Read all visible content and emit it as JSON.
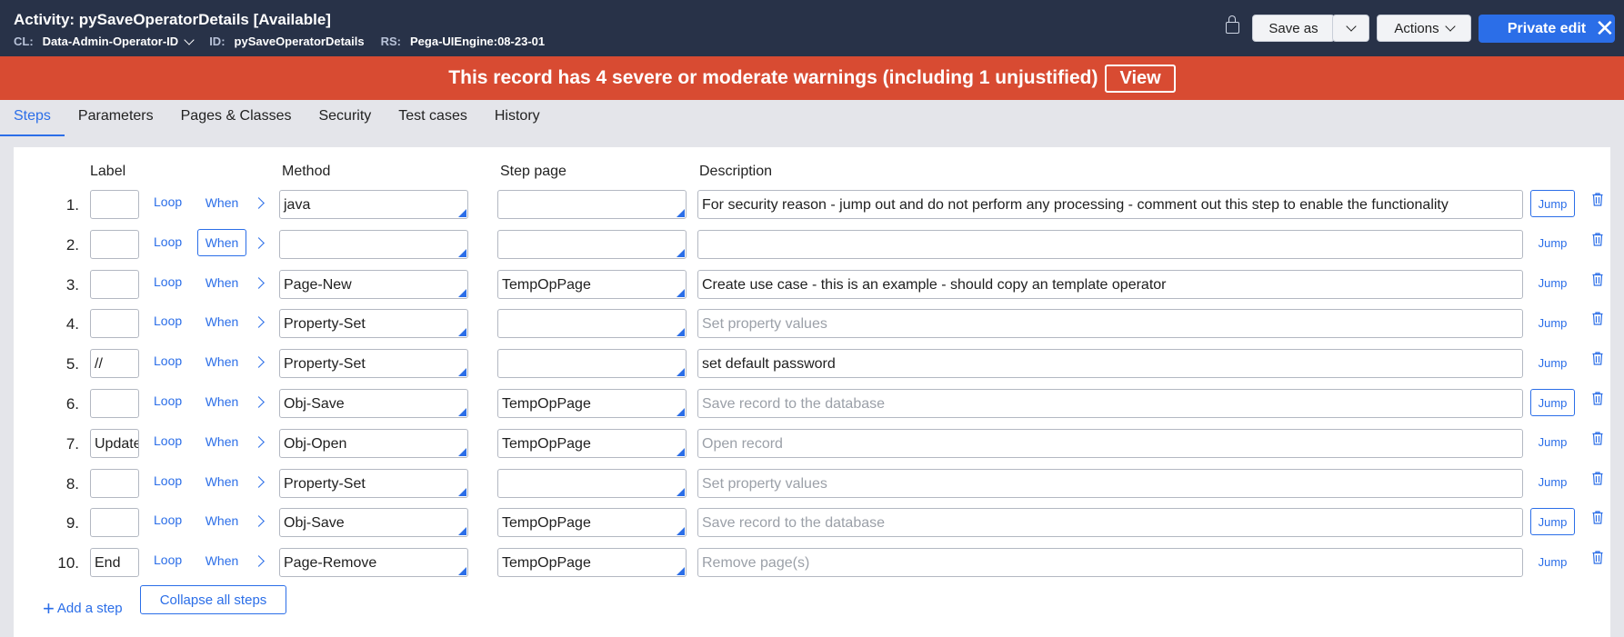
{
  "header": {
    "title": "Activity: pySaveOperatorDetails [Available]",
    "cl_key": "CL:",
    "cl_value": "Data-Admin-Operator-ID",
    "id_key": "ID:",
    "id_value": "pySaveOperatorDetails",
    "rs_key": "RS:",
    "rs_value": "Pega-UIEngine:08-23-01",
    "save_as_label": "Save as",
    "actions_label": "Actions",
    "private_edit_label": "Private edit",
    "close_glyph": "✕",
    "lock_icon": "lock-icon"
  },
  "banner": {
    "text": "This record has 4 severe or moderate warnings (including 1 unjustified)",
    "view_label": "View"
  },
  "tabs": [
    "Steps",
    "Parameters",
    "Pages & Classes",
    "Security",
    "Test cases",
    "History"
  ],
  "columns": {
    "label": "Label",
    "method": "Method",
    "step_page": "Step page",
    "description": "Description"
  },
  "row_actions": {
    "loop": "Loop",
    "when": "When",
    "jump": "Jump"
  },
  "steps": [
    {
      "num": "1.",
      "label": "",
      "method": "java",
      "step_page": "",
      "description": "For security reason - jump out and do not perform any processing - comment out this step to enable the functionality",
      "placeholder": false,
      "when_boxed": false,
      "jump_boxed": true
    },
    {
      "num": "2.",
      "label": "",
      "method": "",
      "step_page": "",
      "description": "",
      "placeholder": false,
      "when_boxed": true,
      "jump_boxed": false
    },
    {
      "num": "3.",
      "label": "",
      "method": "Page-New",
      "step_page": "TempOpPage",
      "description": "Create use case - this is an example - should copy an template operator",
      "placeholder": false,
      "when_boxed": false,
      "jump_boxed": false
    },
    {
      "num": "4.",
      "label": "",
      "method": "Property-Set",
      "step_page": "",
      "description": "Set property values",
      "placeholder": true,
      "when_boxed": false,
      "jump_boxed": false
    },
    {
      "num": "5.",
      "label": "//",
      "method": "Property-Set",
      "step_page": "",
      "description": "set default password",
      "placeholder": false,
      "when_boxed": false,
      "jump_boxed": false
    },
    {
      "num": "6.",
      "label": "",
      "method": "Obj-Save",
      "step_page": "TempOpPage",
      "description": "Save record to the database",
      "placeholder": true,
      "when_boxed": false,
      "jump_boxed": true
    },
    {
      "num": "7.",
      "label": "Update",
      "method": "Obj-Open",
      "step_page": "TempOpPage",
      "description": "Open record",
      "placeholder": true,
      "when_boxed": false,
      "jump_boxed": false
    },
    {
      "num": "8.",
      "label": "",
      "method": "Property-Set",
      "step_page": "",
      "description": "Set property values",
      "placeholder": true,
      "when_boxed": false,
      "jump_boxed": false
    },
    {
      "num": "9.",
      "label": "",
      "method": "Obj-Save",
      "step_page": "TempOpPage",
      "description": "Save record to the database",
      "placeholder": true,
      "when_boxed": false,
      "jump_boxed": true
    },
    {
      "num": "10.",
      "label": "End",
      "method": "Page-Remove",
      "step_page": "TempOpPage",
      "description": "Remove page(s)",
      "placeholder": true,
      "when_boxed": false,
      "jump_boxed": false
    }
  ],
  "footer": {
    "add_step_label": "Add a step",
    "collapse_label": "Collapse all steps"
  },
  "colors": {
    "header_bg": "#283248",
    "banner_bg": "#d84b32",
    "accent": "#2b6ee8"
  }
}
